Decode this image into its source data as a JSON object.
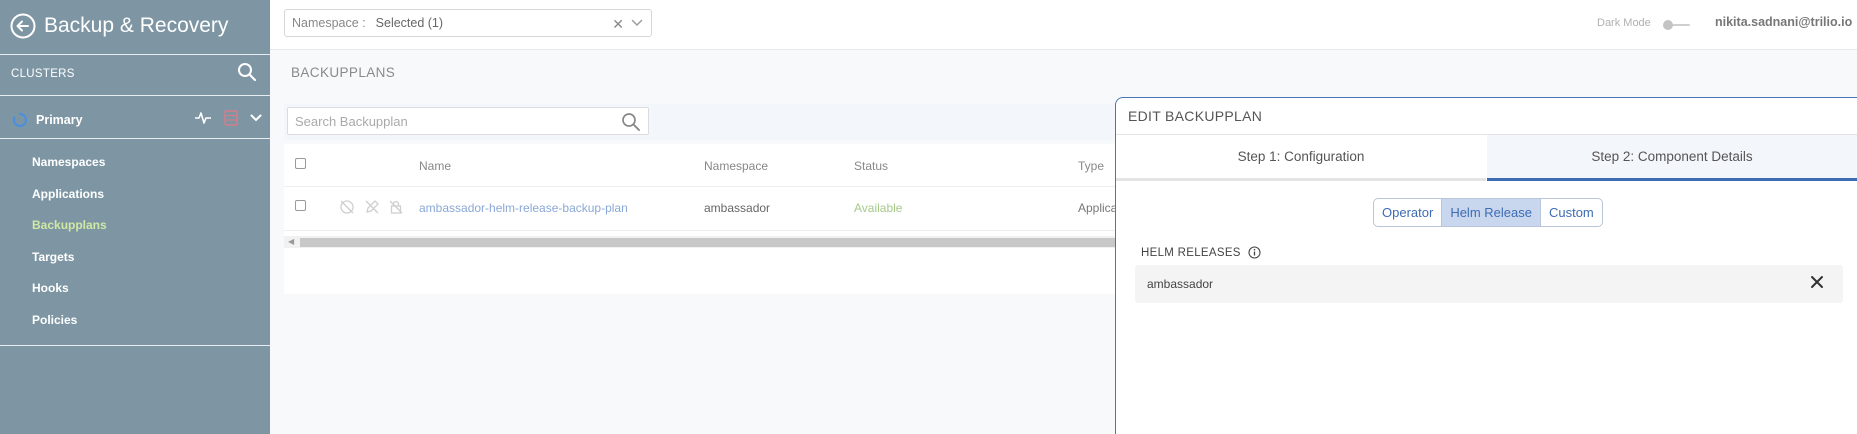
{
  "sidebar": {
    "title": "Backup & Recovery",
    "clusters_label": "CLUSTERS",
    "cluster_name": "Primary",
    "nav": [
      {
        "label": "Namespaces"
      },
      {
        "label": "Applications"
      },
      {
        "label": "Backupplans"
      },
      {
        "label": "Targets"
      },
      {
        "label": "Hooks"
      },
      {
        "label": "Policies"
      }
    ],
    "active_nav": "Backupplans"
  },
  "topbar": {
    "namespace_label": "Namespace :",
    "namespace_value": "Selected (1)",
    "dark_mode_label": "Dark Mode",
    "user": "nikita.sadnani@trilio.io"
  },
  "main": {
    "section_title": "BACKUPPLANS",
    "search_placeholder": "Search Backupplan",
    "columns": [
      "Name",
      "Namespace",
      "Status",
      "Type"
    ],
    "rows": [
      {
        "name": "ambassador-helm-release-backup-plan",
        "namespace": "ambassador",
        "status": "Available",
        "type": "Applicat"
      }
    ]
  },
  "panel": {
    "title": "EDIT BACKUPPLAN",
    "tabs": [
      "Step 1: Configuration",
      "Step 2: Component Details"
    ],
    "segments": [
      "Operator",
      "Helm Release",
      "Custom"
    ],
    "selected_segment": "Helm Release",
    "helm_label": "HELM RELEASES",
    "helm_items": [
      "ambassador"
    ]
  },
  "colors": {
    "sidebar_bg": "#7e96a4",
    "active_nav": "#cfe8a4",
    "accent": "#3e6cb4",
    "status_available": "#a6c98a",
    "link": "#8aa8d6"
  }
}
